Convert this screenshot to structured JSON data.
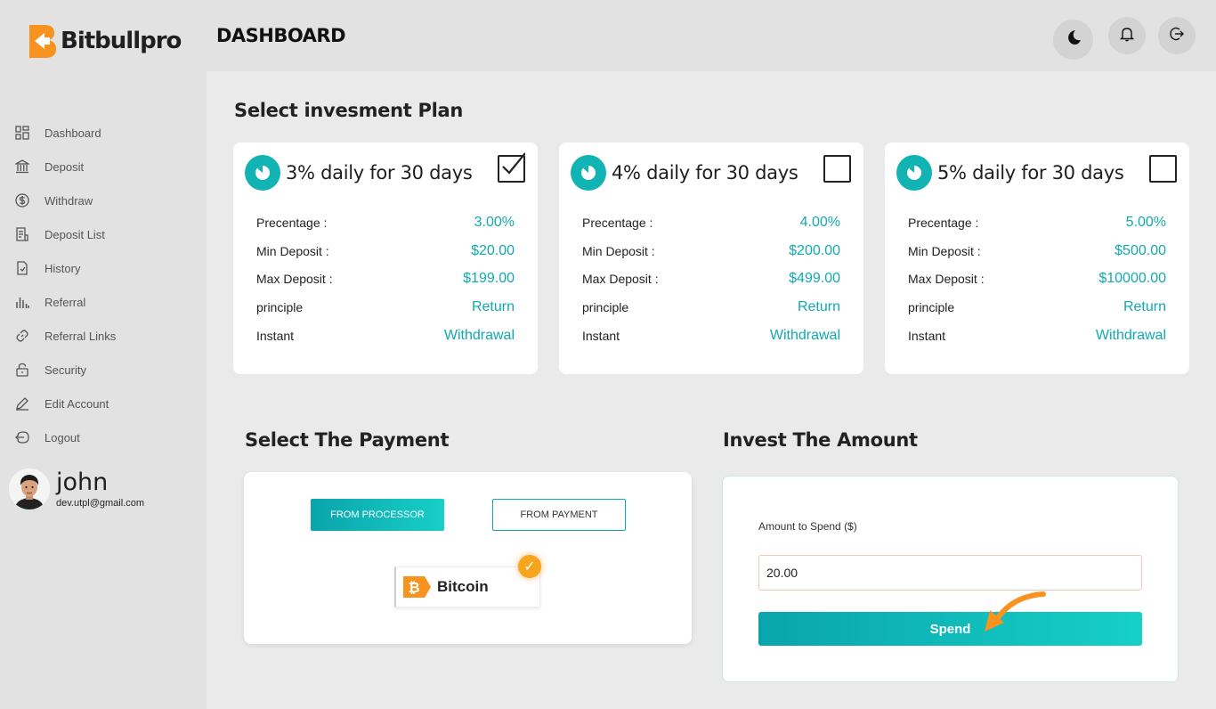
{
  "brand": {
    "name": "Bitbullpro",
    "accent": "#f7931e",
    "teal": "#11b3b3"
  },
  "sidebar": {
    "items": [
      {
        "label": "Dashboard",
        "icon": "dashboard-icon"
      },
      {
        "label": "Deposit",
        "icon": "bank-icon"
      },
      {
        "label": "Withdraw",
        "icon": "dollar-circle-icon"
      },
      {
        "label": "Deposit List",
        "icon": "list-icon"
      },
      {
        "label": "History",
        "icon": "file-icon"
      },
      {
        "label": "Referral",
        "icon": "bar-chart-icon"
      },
      {
        "label": "Referral Links",
        "icon": "link-icon"
      },
      {
        "label": "Security",
        "icon": "lock-icon"
      },
      {
        "label": "Edit Account",
        "icon": "pen-icon"
      },
      {
        "label": "Logout",
        "icon": "logout-icon"
      }
    ]
  },
  "user": {
    "name": "john",
    "email": "dev.utpl@gmail.com"
  },
  "header": {
    "title": "DASHBOARD"
  },
  "plans_section": {
    "title": "Select invesment Plan"
  },
  "plans": [
    {
      "title": "3% daily for 30 days",
      "checked": true,
      "rows": [
        {
          "label": "Precentage :",
          "value": "3.00%"
        },
        {
          "label": "Min Deposit :",
          "value": "$20.00"
        },
        {
          "label": "Max Deposit :",
          "value": "$199.00"
        },
        {
          "label": "principle",
          "value": "Return"
        },
        {
          "label": "Instant",
          "value": "Withdrawal"
        }
      ]
    },
    {
      "title": "4% daily for 30 days",
      "checked": false,
      "rows": [
        {
          "label": "Precentage :",
          "value": "4.00%"
        },
        {
          "label": "Min Deposit :",
          "value": "$200.00"
        },
        {
          "label": "Max Deposit :",
          "value": "$499.00"
        },
        {
          "label": "principle",
          "value": "Return"
        },
        {
          "label": "Instant",
          "value": "Withdrawal"
        }
      ]
    },
    {
      "title": "5% daily for 30 days",
      "checked": false,
      "rows": [
        {
          "label": "Precentage :",
          "value": "5.00%"
        },
        {
          "label": "Min Deposit :",
          "value": "$500.00"
        },
        {
          "label": "Max Deposit :",
          "value": "$10000.00"
        },
        {
          "label": "principle",
          "value": "Return"
        },
        {
          "label": "Instant",
          "value": "Withdrawal"
        }
      ]
    }
  ],
  "payment": {
    "title": "Select The Payment",
    "tab_processor": "FROM PROCESSOR",
    "tab_payment": "FROM PAYMENT",
    "method": "Bitcoin"
  },
  "invest": {
    "title": "Invest The Amount",
    "amount_label": "Amount to Spend ($)",
    "amount_value": "20.00",
    "spend_label": "Spend"
  }
}
